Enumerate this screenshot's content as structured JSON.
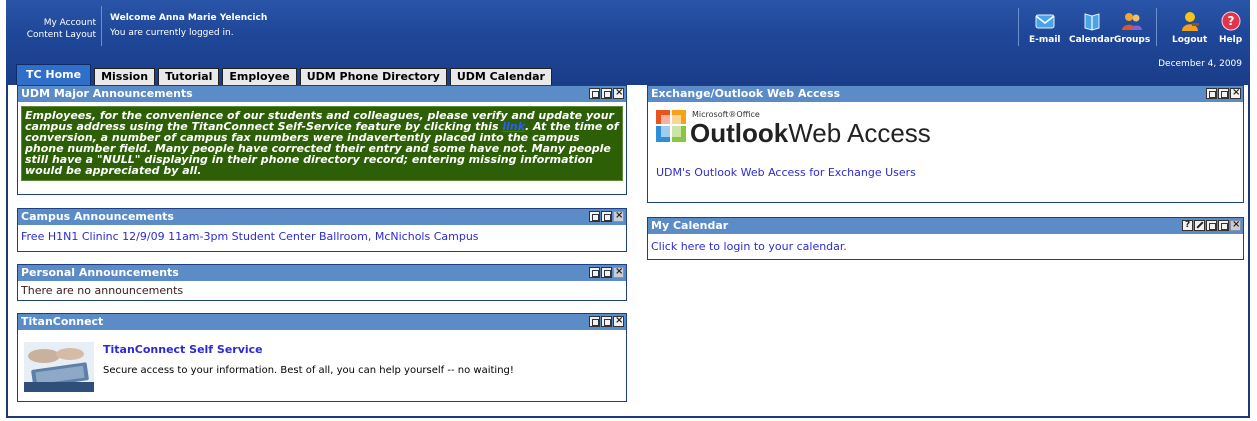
{
  "header": {
    "account_link_1": "My Account",
    "account_link_2": "Content Layout",
    "welcome_title": "Welcome Anna Marie Yelencich",
    "welcome_sub": "You are currently logged in.",
    "date": "December 4, 2009",
    "icons": [
      {
        "label": "E-mail",
        "icon": "envelope-icon",
        "color": "#4aa3e8"
      },
      {
        "label": "Calendar",
        "icon": "calendar-book-icon",
        "color": "#4aa3e8"
      },
      {
        "label": "Groups",
        "icon": "users-icon",
        "color": "#f2a52c"
      },
      {
        "label": "Logout",
        "icon": "user-key-icon",
        "color": "#f5c518"
      },
      {
        "label": "Help",
        "icon": "help-icon",
        "color": "#e0354a"
      }
    ]
  },
  "tabs": [
    "TC Home",
    "Mission",
    "Tutorial",
    "Employee",
    "UDM Phone Directory",
    "UDM Calendar"
  ],
  "portlets": {
    "udm": {
      "title": "UDM Major Announcements",
      "text_before": "Employees, for the convenience of our students and colleagues, please verify and update your campus address using the TitanConnect Self-Service feature by clicking this",
      "link": "link",
      "text_after": ". At the time of conversion, a number of campus fax numbers were indavertently placed into the campus phone number field. Many people have corrected their entry and some have not. Many people still have a \"NULL\" displaying in their phone directory record; entering missing information would be appreciated by all."
    },
    "campus": {
      "title": "Campus Announcements",
      "item": "Free H1N1 Clininc 12/9/09 11am-3pm Student Center Ballroom, McNichols Campus"
    },
    "personal": {
      "title": "Personal Announcements",
      "text": "There are no announcements"
    },
    "titan": {
      "title": "TitanConnect",
      "link": "TitanConnect Self Service",
      "text": "Secure access to your information. Best of all, you can help yourself -- no waiting!"
    },
    "exchange": {
      "title": "Exchange/Outlook Web Access",
      "logo_small": "Microsoft®Office",
      "logo_big1": "Outlook",
      "logo_big2": "Web Access",
      "link": "UDM's Outlook Web Access for Exchange Users"
    },
    "calendar": {
      "title": "My Calendar",
      "link": "Click here to login to your calendar."
    }
  },
  "colors": {
    "header_blue": "#1f4799",
    "portlet_head": "#5b8cc7",
    "announcement_green": "#2d5f06",
    "link_blue": "#2b2bd6"
  }
}
